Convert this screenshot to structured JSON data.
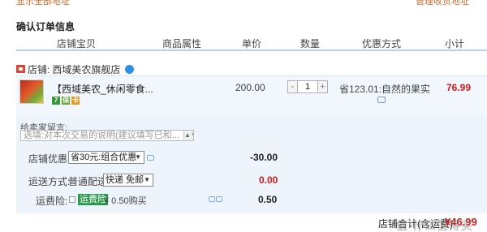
{
  "top_links": {
    "left": "显示全部地址",
    "right": "管理收货地址"
  },
  "section_title": "确认订单信息",
  "columns": [
    "店铺宝贝",
    "商品属性",
    "单价",
    "数量",
    "优惠方式",
    "小计"
  ],
  "shop": {
    "label": "店铺:",
    "name": "西域美农旗舰店"
  },
  "item": {
    "title": "【西域美农_休闲零食...",
    "badges": [
      "7",
      "保",
      "卡"
    ],
    "unit_price": "200.00",
    "quantity": "1",
    "qty_minus": "-",
    "qty_plus": "+",
    "promo_text": "省123.01:自然的果实",
    "subtotal": "76.99"
  },
  "memo": {
    "label": "给卖家留言:",
    "placeholder": "选填:对本次交易的说明(建议填写已和...",
    "scroll_glyph": "▲▼"
  },
  "shop_discount": {
    "label": "店铺优惠:",
    "selected": "省30元:组合优惠",
    "amount": "-30.00"
  },
  "shipping": {
    "label": "运送方式:",
    "method": "普通配送",
    "selected": "快递 免邮",
    "amount": "0.00"
  },
  "insurance": {
    "label": "运费险:",
    "tag": "运费险",
    "text": "¥ 0.50购买",
    "amount": "0.50"
  },
  "total": {
    "label": "店铺合计(含运费)",
    "value": "¥46.99"
  },
  "watermark": "值 什么值得买"
}
